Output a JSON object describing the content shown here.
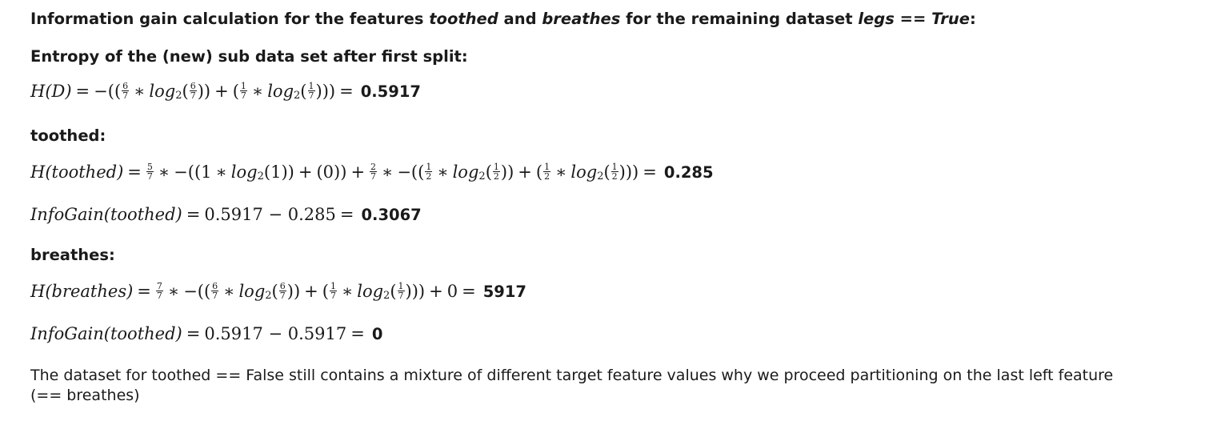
{
  "heading": {
    "prefix": "Information gain calculation for the features ",
    "feature1": "toothed",
    "and": " and ",
    "feature2": "breathes",
    "middle": " for the remaining dataset ",
    "condition_var": "legs",
    "condition_op": " == ",
    "condition_val": "True",
    "suffix": ":"
  },
  "entropy_label": "Entropy of the (new) sub data set after first split:",
  "formula_hd": {
    "lhs": "H(D)",
    "result": "0.5917",
    "frac_a_num": "6",
    "frac_a_den": "7",
    "frac_b_num": "1",
    "frac_b_den": "7",
    "log": "log",
    "base": "2"
  },
  "toothed_label": "toothed:",
  "formula_toothed": {
    "lhs": "H(toothed)",
    "result": "0.285",
    "w1_num": "5",
    "w1_den": "7",
    "w2_num": "2",
    "w2_den": "7",
    "p_num": "1",
    "p_den": "2",
    "one": "1",
    "zero": "0",
    "log": "log",
    "base": "2"
  },
  "infogain_toothed": {
    "lhs": "InfoGain(toothed)",
    "expr": "0.5917 − 0.285",
    "result": "0.3067"
  },
  "breathes_label": "breathes:",
  "formula_breathes": {
    "lhs": "H(breathes)",
    "result": "5917",
    "w_num": "7",
    "w_den": "7",
    "a_num": "6",
    "a_den": "7",
    "b_num": "1",
    "b_den": "7",
    "plus_zero": "0",
    "log": "log",
    "base": "2"
  },
  "infogain_breathes": {
    "lhs": "InfoGain(toothed)",
    "expr": "0.5917 − 0.5917",
    "result": "0"
  },
  "conclusion": "The dataset for toothed == False still contains a mixture of different target feature values why we proceed partitioning on the last left feature (== breathes)"
}
